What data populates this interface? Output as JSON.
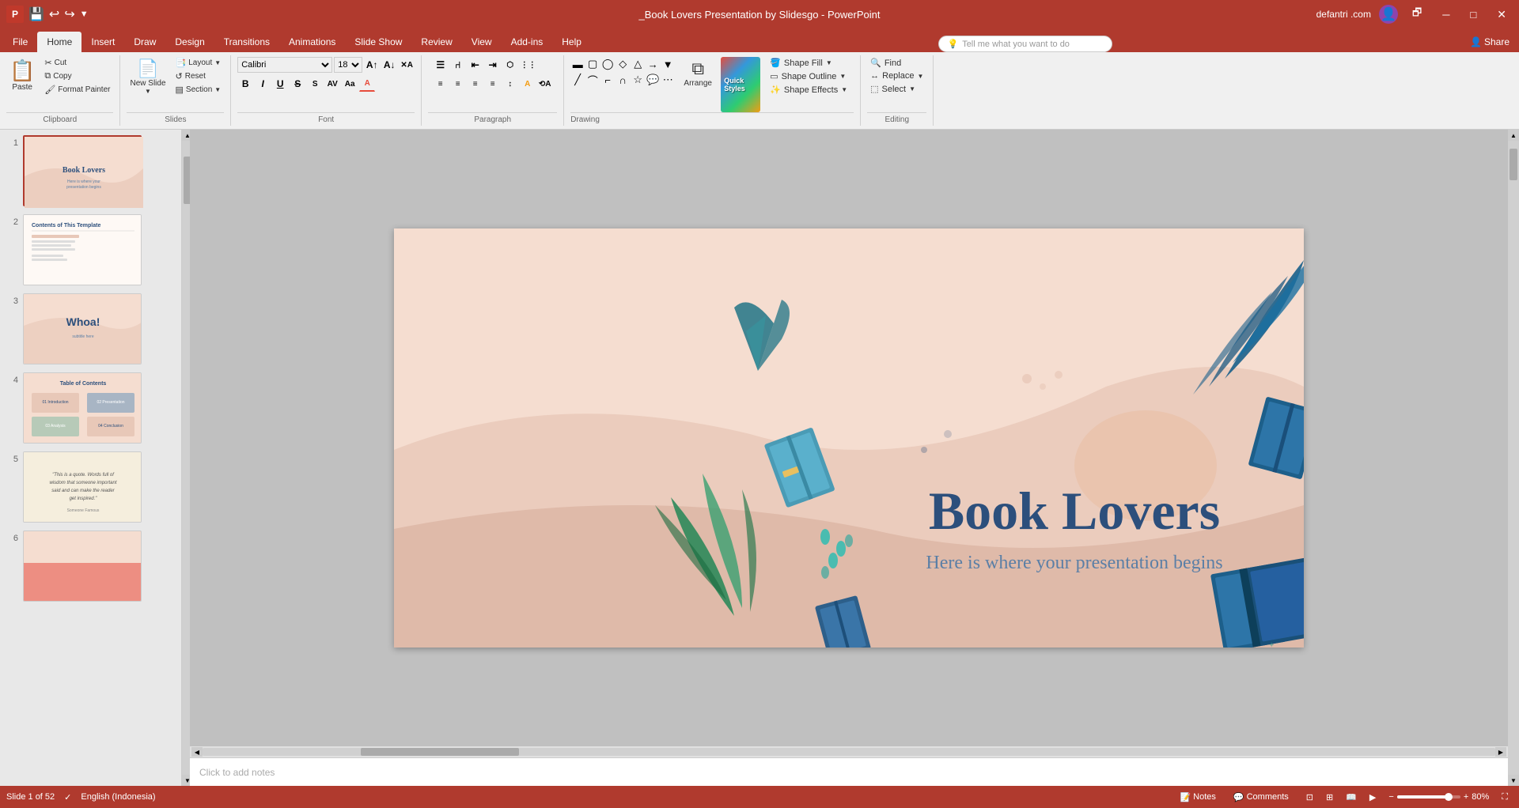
{
  "window": {
    "title": "_Book Lovers Presentation by Slidesgo - PowerPoint",
    "user": "defantri .com"
  },
  "tabs": {
    "active": "Home",
    "items": [
      "File",
      "Home",
      "Insert",
      "Draw",
      "Design",
      "Transitions",
      "Animations",
      "Slide Show",
      "Review",
      "View",
      "Add-ins",
      "Help"
    ]
  },
  "ribbon": {
    "clipboard": {
      "label": "Clipboard",
      "paste": "Paste",
      "cut": "✂",
      "copy": "⧉",
      "format_painter": "🖌"
    },
    "slides": {
      "label": "Slides",
      "new_slide": "New Slide",
      "layout": "Layout",
      "reset": "Reset",
      "section": "Section"
    },
    "font": {
      "label": "Font",
      "family": "Calibri",
      "size": "18",
      "bold": "B",
      "italic": "I",
      "underline": "U",
      "strikethrough": "S"
    },
    "paragraph": {
      "label": "Paragraph"
    },
    "drawing": {
      "label": "Drawing",
      "arrange": "Arrange",
      "quick_styles": "Quick Styles",
      "shape_fill": "Shape Fill",
      "shape_outline": "Shape Outline",
      "shape_effects": "Shape Effects"
    },
    "editing": {
      "label": "Editing",
      "find": "Find",
      "replace": "Replace",
      "select": "Select"
    },
    "tell_me": {
      "placeholder": "Tell me what you want to do"
    },
    "share": "Share"
  },
  "slide_panel": {
    "slides": [
      {
        "num": 1,
        "active": true,
        "bg": "#f5ddd0",
        "label": "Book Lovers title slide"
      },
      {
        "num": 2,
        "active": false,
        "bg": "#f5ddd0",
        "label": "Contents slide"
      },
      {
        "num": 3,
        "active": false,
        "bg": "#f5ddd0",
        "label": "Whoa slide"
      },
      {
        "num": 4,
        "active": false,
        "bg": "#f5ddd0",
        "label": "Table of Contents"
      },
      {
        "num": 5,
        "active": false,
        "bg": "#f5eedd",
        "label": "Quote slide"
      },
      {
        "num": 6,
        "active": false,
        "bg": "#f5ddd0",
        "label": "Coral slide"
      }
    ]
  },
  "main_slide": {
    "title": "Book Lovers",
    "subtitle": "Here is where your presentation begins",
    "bg_color": "#f5ddd0"
  },
  "notes": {
    "placeholder": "Click to add notes"
  },
  "status_bar": {
    "slide_info": "Slide 1 of 52",
    "language": "English (Indonesia)",
    "notes_btn": "Notes",
    "comments_btn": "Comments",
    "zoom": "80%"
  }
}
